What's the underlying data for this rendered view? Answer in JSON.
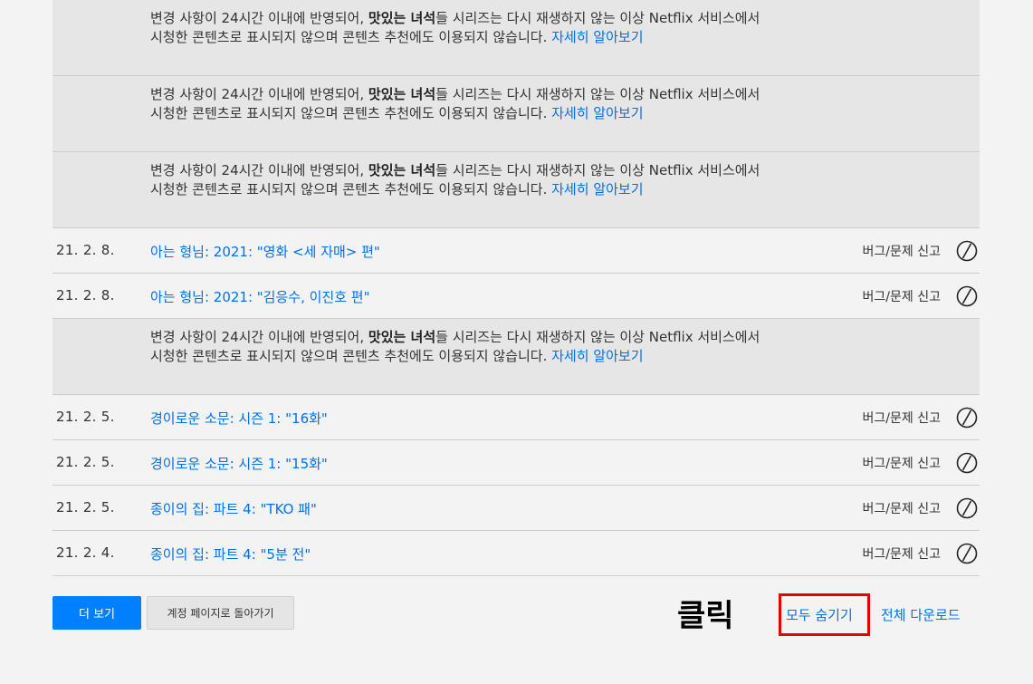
{
  "notice": {
    "before": "변경 사항이 24시간 이내에 반영되어, ",
    "bold": "맛있는 녀석",
    "after": "들 시리즈는 다시 재생하지 않는 이상 Netflix 서비스에서 시청한 콘텐츠로 표시되지 않으며 콘텐츠 추천에도 이용되지 않습니다. ",
    "link": "자세히 알아보기"
  },
  "rows": [
    {
      "type": "notice"
    },
    {
      "type": "notice"
    },
    {
      "type": "notice"
    },
    {
      "type": "item",
      "date": "21. 2. 8.",
      "title": "아는 형님: 2021: \"영화 <세 자매> 편\"",
      "report": "버그/문제 신고"
    },
    {
      "type": "item",
      "date": "21. 2. 8.",
      "title": "아는 형님: 2021: \"김응수, 이진호 편\"",
      "report": "버그/문제 신고"
    },
    {
      "type": "notice"
    },
    {
      "type": "item",
      "date": "21. 2. 5.",
      "title": "경이로운 소문: 시즌 1: \"16화\"",
      "report": "버그/문제 신고"
    },
    {
      "type": "item",
      "date": "21. 2. 5.",
      "title": "경이로운 소문: 시즌 1: \"15화\"",
      "report": "버그/문제 신고"
    },
    {
      "type": "item",
      "date": "21. 2. 5.",
      "title": "종이의 집: 파트 4: \"TKO 패\"",
      "report": "버그/문제 신고"
    },
    {
      "type": "item",
      "date": "21. 2. 4.",
      "title": "종이의 집: 파트 4: \"5분 전\"",
      "report": "버그/문제 신고"
    }
  ],
  "footer": {
    "more_label": "더 보기",
    "back_label": "계정 페이지로 돌아가기",
    "click_annotation": "클릭",
    "hide_all_label": "모두 숨기기",
    "download_label": "전체 다운로드"
  },
  "colors": {
    "link": "#0071eb",
    "primary_button": "#0080ff",
    "annotation_box": "#e60000",
    "notice_bg": "#e6e6e6",
    "page_bg": "#f3f3f3"
  },
  "icons": {
    "hide": "hide-from-history-icon"
  }
}
